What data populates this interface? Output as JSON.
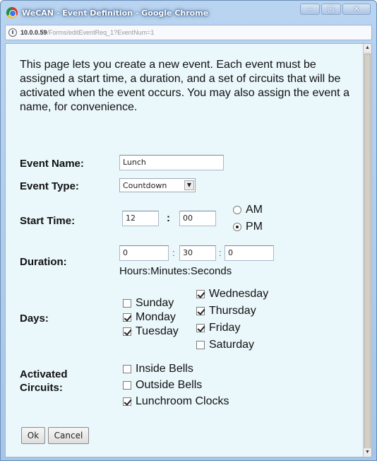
{
  "window": {
    "title": "WeCAN - Event Definition - Google Chrome",
    "controls": {
      "minimize": "–",
      "maximize": "▢",
      "close": "✕"
    }
  },
  "address_bar": {
    "host": "10.0.0.59",
    "path": "/Forms/editEventReq_1?EventNum=1"
  },
  "page": {
    "intro": "This page lets you create a new event. Each event must be assigned a start time, a duration, and a set of circuits that will be activated when the event occurs. You may also assign the event a name, for convenience.",
    "event_name": {
      "label": "Event Name:",
      "value": "Lunch"
    },
    "event_type": {
      "label": "Event Type:",
      "value": "Countdown"
    },
    "start_time": {
      "label": "Start Time:",
      "hour": "12",
      "separator": ":",
      "minute": "00",
      "am_label": "AM",
      "pm_label": "PM",
      "selected": "PM"
    },
    "duration": {
      "label": "Duration:",
      "hours": "0",
      "minutes": "30",
      "seconds": "0",
      "separator": ":",
      "hint": "Hours:Minutes:Seconds"
    },
    "days": {
      "label": "Days:",
      "left_column": [
        {
          "label": "Sunday",
          "checked": false
        },
        {
          "label": "Monday",
          "checked": true
        },
        {
          "label": "Tuesday",
          "checked": true
        }
      ],
      "right_column": [
        {
          "label": "Wednesday",
          "checked": true
        },
        {
          "label": "Thursday",
          "checked": true
        },
        {
          "label": "Friday",
          "checked": true
        },
        {
          "label": "Saturday",
          "checked": false
        }
      ]
    },
    "circuits": {
      "label": "Activated Circuits:",
      "items": [
        {
          "label": "Inside Bells",
          "checked": false
        },
        {
          "label": "Outside Bells",
          "checked": false
        },
        {
          "label": "Lunchroom Clocks",
          "checked": true
        }
      ]
    },
    "buttons": {
      "ok": "Ok",
      "cancel": "Cancel"
    }
  },
  "icons": {
    "app": "chrome-icon",
    "page": "page-info-icon",
    "select_arrow": "chevron-down-icon"
  },
  "colors": {
    "page_background": "#eaf7fb",
    "window_frame": "#a6c6e8"
  }
}
